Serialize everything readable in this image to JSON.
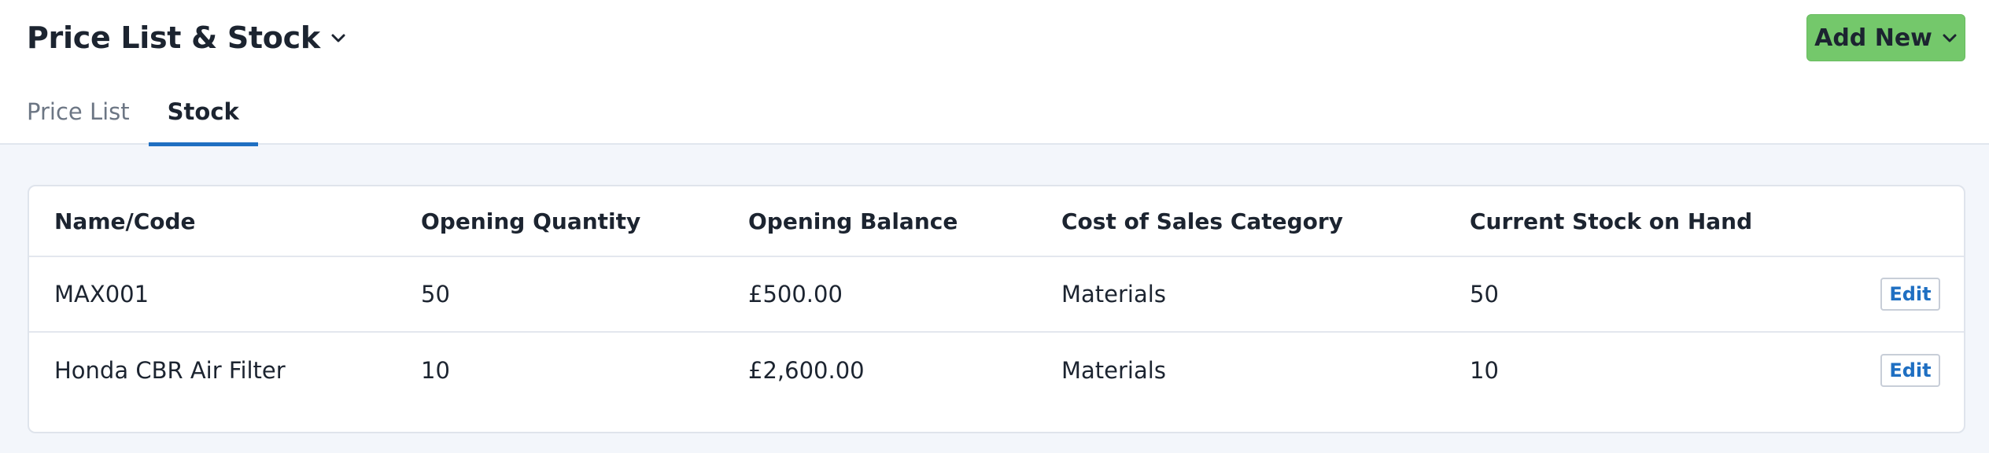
{
  "header": {
    "title": "Price List & Stock",
    "add_new_label": "Add New"
  },
  "tabs": [
    {
      "label": "Price List",
      "active": false
    },
    {
      "label": "Stock",
      "active": true
    }
  ],
  "table": {
    "columns": [
      "Name/Code",
      "Opening Quantity",
      "Opening Balance",
      "Cost of Sales Category",
      "Current Stock on Hand"
    ],
    "rows": [
      {
        "name": "MAX001",
        "opening_quantity": "50",
        "opening_balance": "£500.00",
        "category": "Materials",
        "stock_on_hand": "50",
        "action": "Edit"
      },
      {
        "name": "Honda CBR Air Filter",
        "opening_quantity": "10",
        "opening_balance": "£2,600.00",
        "category": "Materials",
        "stock_on_hand": "10",
        "action": "Edit"
      }
    ]
  },
  "colors": {
    "accent": "#1f6fc2",
    "add_button": "#74c86b",
    "background": "#f3f6fb"
  },
  "icons": {
    "title_dropdown": "chevron-down-icon",
    "add_new_dropdown": "chevron-down-icon"
  }
}
